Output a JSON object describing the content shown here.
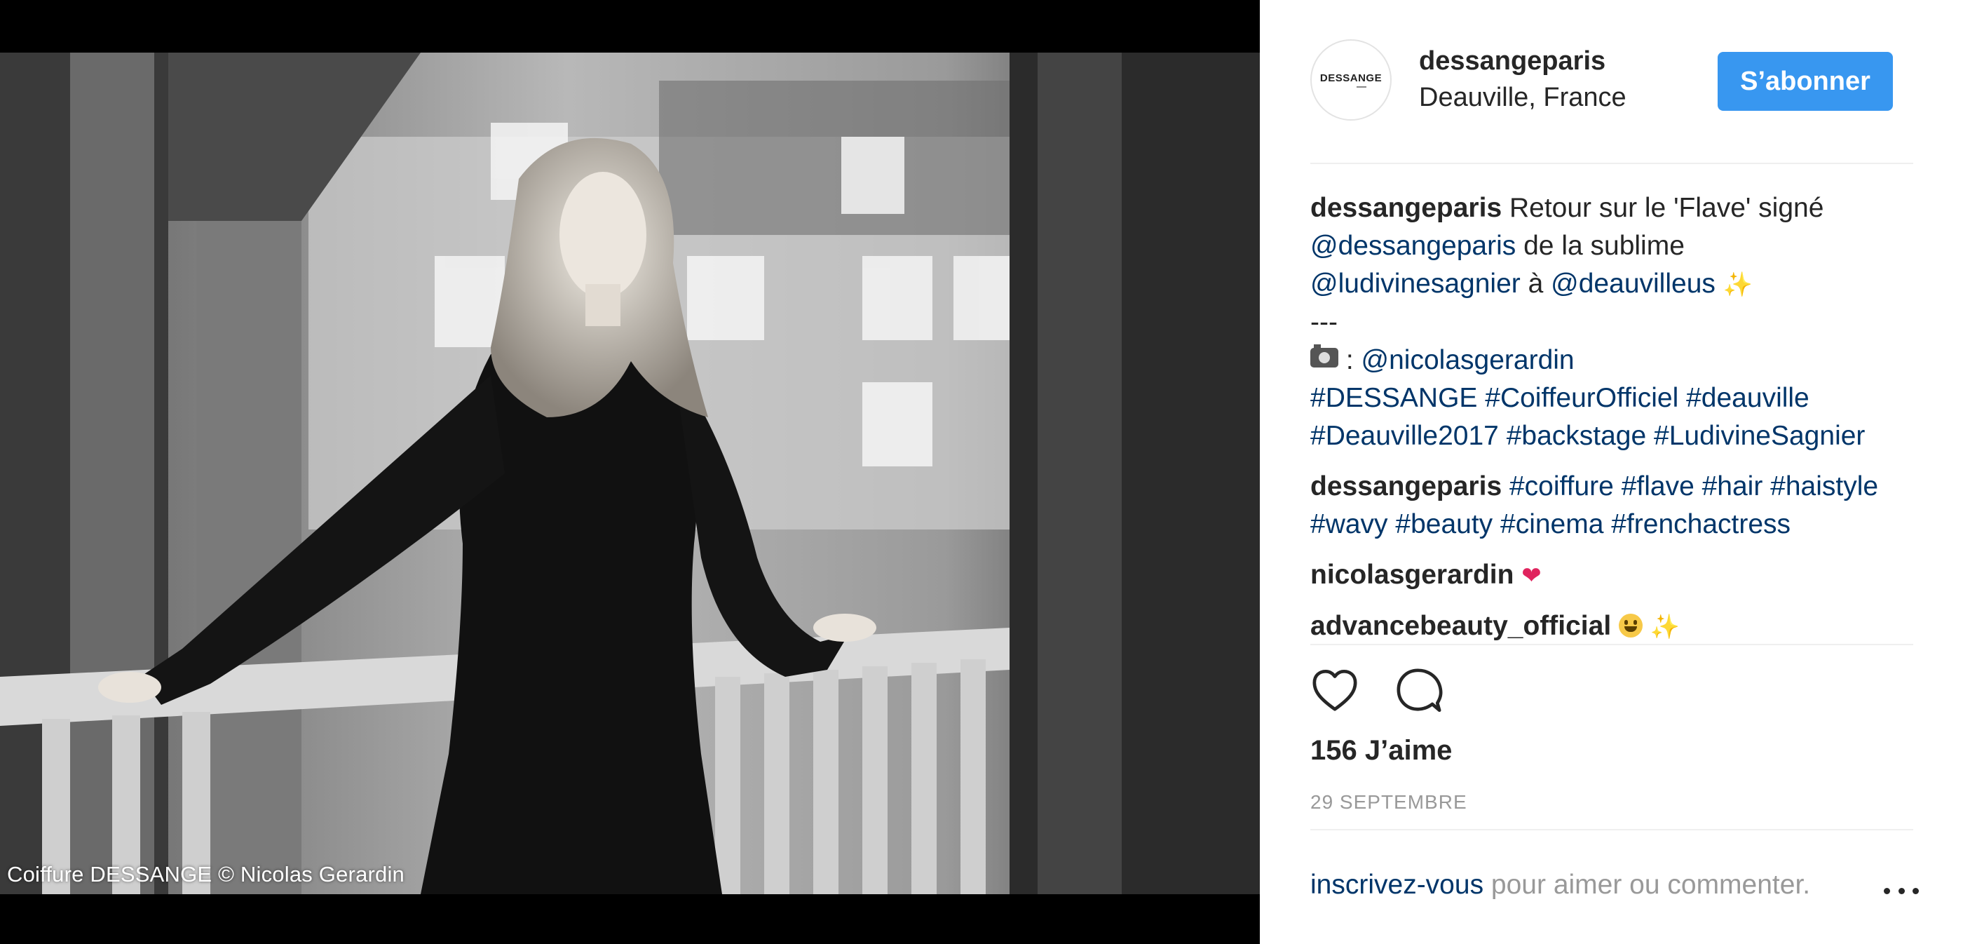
{
  "photo": {
    "caption": "Coiffure DESSANGE © Nicolas Gerardin"
  },
  "header": {
    "avatar_text": "DESSANGE",
    "username": "dessangeparis",
    "location": "Deauville, France",
    "follow_label": "S’abonner"
  },
  "comments": [
    {
      "author": "dessangeparis",
      "line1": "Retour sur le 'Flave' signé",
      "mention1": "@dessangeparis",
      "text2": "de la sublime",
      "mention2": "@ludivinesagnier",
      "text3": "à",
      "mention3": "@deauvilleus",
      "separator": "---",
      "credit_prefix": ":",
      "credit_mention": "@nicolasgerardin",
      "hashtags_line1": "#DESSANGE #CoiffeurOfficiel #deauville",
      "hashtags_line2": "#Deauville2017 #backstage #LudivineSagnier"
    },
    {
      "author": "dessangeparis",
      "hashtags": "#coiffure #flave #hair #haistyle #wavy #beauty #cinema #frenchactress"
    },
    {
      "author": "nicolasgerardin"
    },
    {
      "author": "advancebeauty_official"
    }
  ],
  "emoji": {
    "sparkles": "✨",
    "heart": "❤"
  },
  "actions": {
    "likes": "156 J’aime",
    "date": "29 SEPTEMBRE"
  },
  "footer": {
    "signup_link": "inscrivez-vous",
    "prompt": "pour aimer ou commenter."
  },
  "colors": {
    "accent": "#3897f0",
    "link": "#003569",
    "text": "#262626",
    "muted": "#999999"
  },
  "icons": [
    "heart-outline-icon",
    "comment-bubble-icon",
    "more-options-icon"
  ]
}
